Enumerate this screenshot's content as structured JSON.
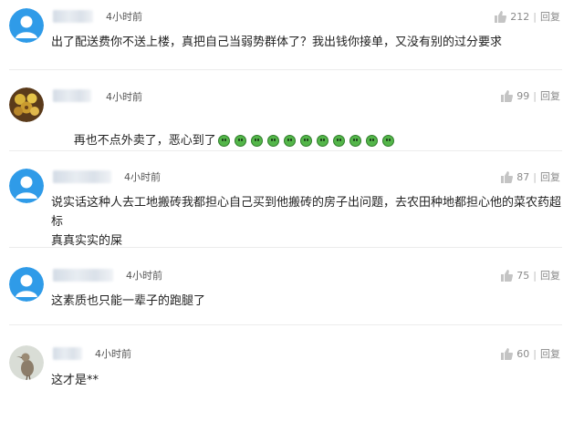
{
  "comments": [
    {
      "time": "4小时前",
      "likes": "212",
      "reply": "回复",
      "text": "出了配送费你不送上楼，真把自己当弱势群体了？我出钱你接单，又没有别的过分要求",
      "avatar": "default"
    },
    {
      "time": "4小时前",
      "likes": "99",
      "reply": "回复",
      "text": "再也不点外卖了，恶心到了",
      "emoji_count": 11,
      "avatar": "photo-flowers"
    },
    {
      "time": "4小时前",
      "likes": "87",
      "reply": "回复",
      "text": "说实话这种人去工地搬砖我都担心自己买到他搬砖的房子出问题，去农田种地都担心他的菜农药超标\n真真实实的屎",
      "avatar": "default"
    },
    {
      "time": "4小时前",
      "likes": "75",
      "reply": "回复",
      "text": "这素质也只能一辈子的跑腿了",
      "avatar": "default"
    },
    {
      "time": "4小时前",
      "likes": "60",
      "reply": "回复",
      "text": "这才是**",
      "avatar": "photo-bird"
    }
  ],
  "colors": {
    "avatar_default": "#2f9be8",
    "emoji_green": "#54b64a"
  }
}
